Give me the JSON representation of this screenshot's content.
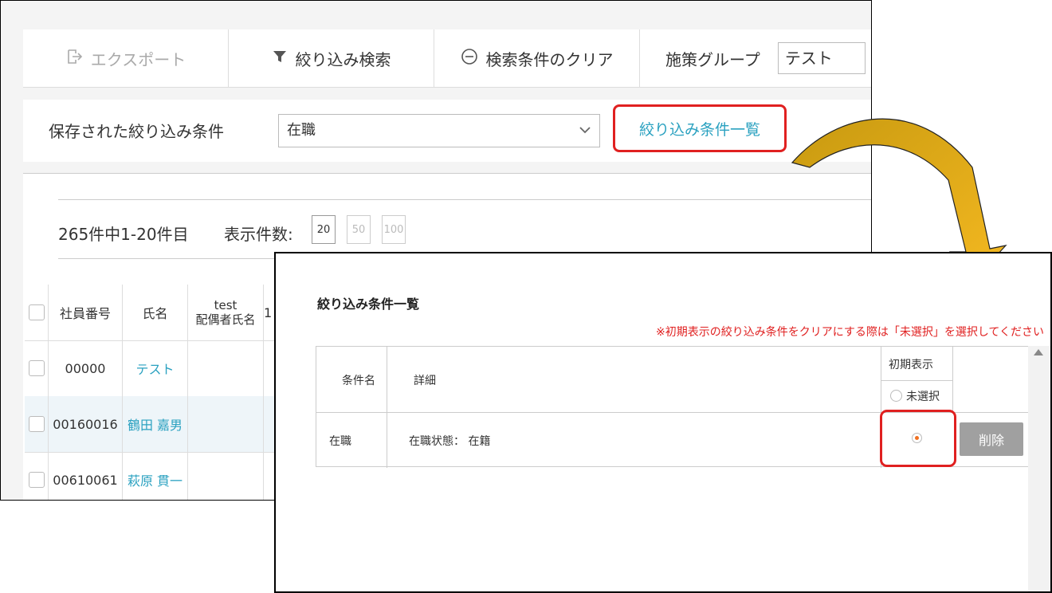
{
  "toolbar": {
    "export_label": "エクスポート",
    "filter_label": "絞り込み検索",
    "clear_label": "検索条件のクリア",
    "group_label": "施策グループ",
    "group_value": "テスト"
  },
  "saved_filters": {
    "label": "保存された絞り込み条件",
    "selected": "在職",
    "list_link": "絞り込み条件一覧"
  },
  "list": {
    "count_text": "265件中1-20件目",
    "per_page_label": "表示件数:",
    "per_page_options": [
      "20",
      "50",
      "100"
    ],
    "columns": {
      "emp_no": "社員番号",
      "name": "氏名",
      "spouse_line1": "test",
      "spouse_line2": "配偶者氏名"
    },
    "column_trailing": "1",
    "rows": [
      {
        "emp_no": "00000",
        "name": "テスト"
      },
      {
        "emp_no": "00160016",
        "name": "鶴田 嘉男"
      },
      {
        "emp_no": "00610061",
        "name": "萩原 貫一"
      }
    ]
  },
  "dialog": {
    "title": "絞り込み条件一覧",
    "note": "※初期表示の絞り込み条件をクリアにする際は「未選択」を選択してください",
    "headers": {
      "name": "条件名",
      "detail": "詳細",
      "initial": "初期表示",
      "unselected": "未選択"
    },
    "rows": [
      {
        "name": "在職",
        "detail": "在職状態： 在籍",
        "delete_label": "削除"
      }
    ]
  },
  "colors": {
    "highlight": "#e02020",
    "link": "#2aa1c0",
    "arrow": "#f5b921"
  }
}
